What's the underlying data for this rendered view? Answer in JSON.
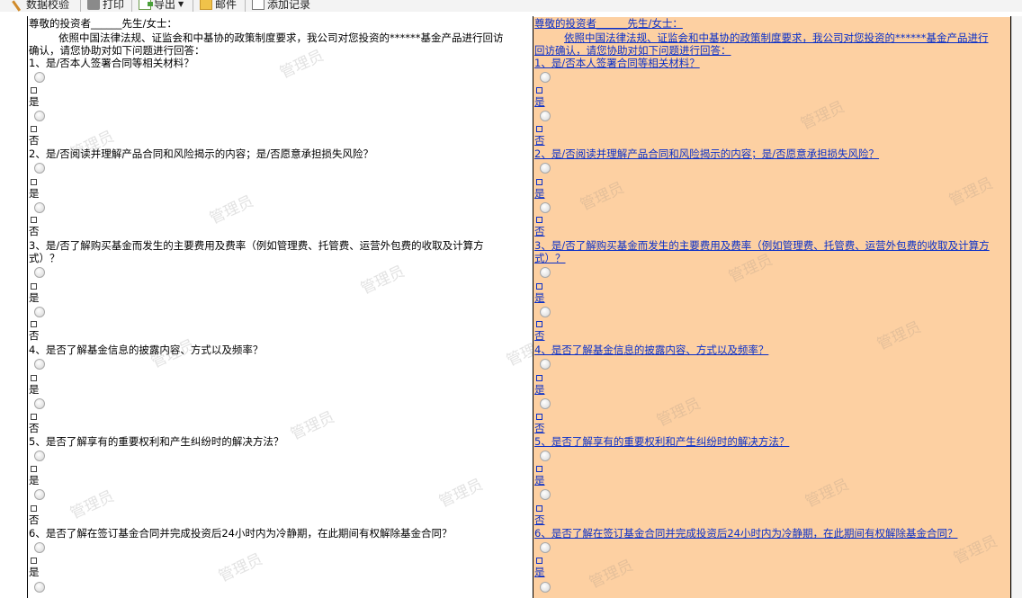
{
  "toolbar": {
    "items": [
      {
        "label": "数据校验",
        "icon": "check-icon"
      },
      {
        "label": "打印",
        "icon": "print-icon"
      },
      {
        "label": "导出",
        "icon": "export-icon"
      },
      {
        "label": "邮件",
        "icon": "mail-icon"
      },
      {
        "label": "添加记录",
        "icon": "add-record-icon"
      }
    ]
  },
  "doc": {
    "greeting": "尊敬的投资者______先生/女士：",
    "intro_1": "依照中国法律法规、证监会和中基协的政策制度要求，我公司对您投资的******基金产品进行回访",
    "intro_2": "确认，请您协助对如下问题进行回答：",
    "yes": "是",
    "no": "否",
    "q1": "1、是/否本人签署合同等相关材料？",
    "q2": "2、是/否阅读并理解产品合同和风险揭示的内容；是/否愿意承担损失风险？",
    "q3a": "3、是/否了解购买基金而发生的主要费用及费率（例如管理费、托管费、运营外包费的收取及计算方",
    "q3b": "式）？",
    "q4": "4、是否了解基金信息的披露内容、方式以及频率？",
    "q5": "5、是否了解享有的重要权利和产生纠纷时的解决方法？",
    "q6": "6、是否了解在签订基金合同并完成投资后24小时内为冷静期，在此期间有权解除基金合同？"
  },
  "right": {
    "greeting": "尊敬的投资者______先生/女士：",
    "intro_1": "依照中国法律法规、证监会和中基协的政策制度要求，我公司对您投资的******基金产品进行",
    "intro_2": "回访确认，请您协助对如下问题进行回答："
  },
  "watermark": "管理员"
}
